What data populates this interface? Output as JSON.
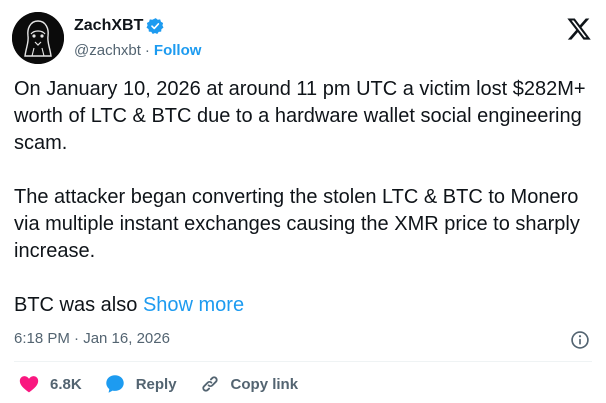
{
  "author": {
    "display_name": "ZachXBT",
    "handle": "@zachxbt",
    "separator": "·",
    "follow_label": "Follow",
    "verified_color": "#1d9bf0"
  },
  "tweet": {
    "paragraphs": [
      "On January 10, 2026 at around 11 pm UTC a victim lost $282M+ worth of LTC & BTC due to a hardware wallet social engineering scam.",
      "The attacker began converting the stolen LTC & BTC to Monero via multiple instant exchanges causing the XMR price to sharply increase."
    ],
    "truncated_text": "BTC was also ",
    "show_more_label": "Show more",
    "timestamp": "6:18 PM · Jan 16, 2026"
  },
  "actions": {
    "like_count": "6.8K",
    "reply_label": "Reply",
    "copy_link_label": "Copy link",
    "like_color": "#f91880",
    "reply_color": "#1d9bf0"
  },
  "icons": [
    "avatar",
    "verified-badge-icon",
    "x-logo-icon",
    "info-icon",
    "heart-icon",
    "reply-bubble-icon",
    "link-icon"
  ]
}
